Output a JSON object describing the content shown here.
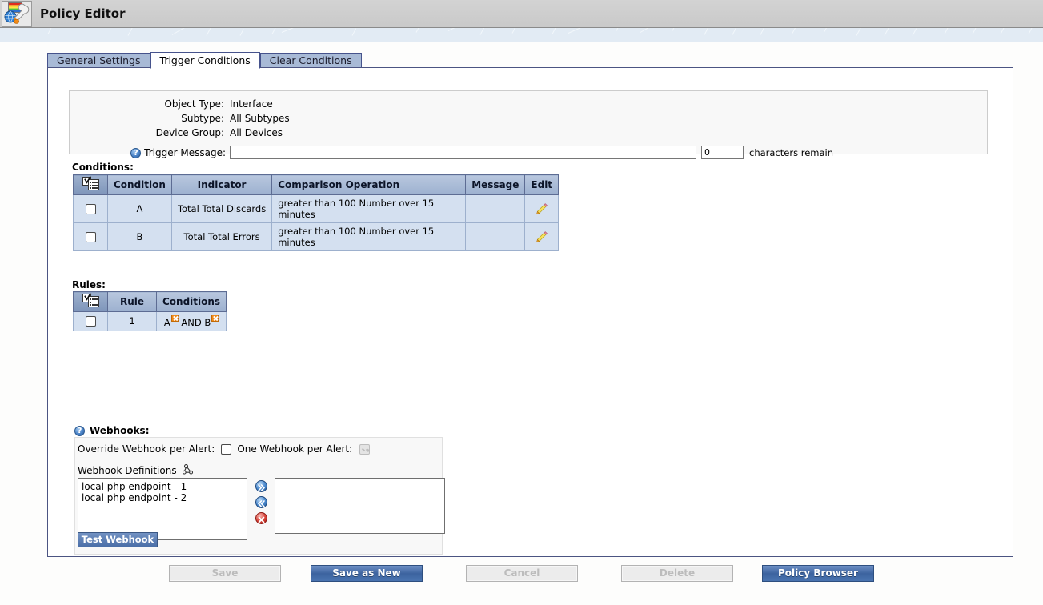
{
  "window": {
    "title": "Policy Editor",
    "app_icon": "globe-wrench-icon"
  },
  "tabs": [
    {
      "label": "General Settings",
      "active": false
    },
    {
      "label": "Trigger Conditions",
      "active": true
    },
    {
      "label": "Clear Conditions",
      "active": false
    }
  ],
  "info": {
    "rows": [
      {
        "label": "Object Type:",
        "value": "Interface"
      },
      {
        "label": "Subtype:",
        "value": "All Subtypes"
      },
      {
        "label": "Device Group:",
        "value": "All Devices"
      }
    ],
    "trigger_message": {
      "help_icon": "help-icon",
      "label": "Trigger Message:",
      "value": "",
      "placeholder": "",
      "count_value": "0",
      "remain_label": "characters remain"
    }
  },
  "conditions": {
    "section_label": "Conditions:",
    "select_all_icon": "select-all-checklist-icon",
    "columns": [
      "",
      "Condition",
      "Indicator",
      "Comparison Operation",
      "Message",
      "Edit"
    ],
    "rows": [
      {
        "checked": false,
        "condition": "A",
        "indicator": "Total Total Discards",
        "comparison": "greater than 100 Number over 15 minutes",
        "message": "",
        "edit_icon": "pencil-icon"
      },
      {
        "checked": false,
        "condition": "B",
        "indicator": "Total Total Errors",
        "comparison": "greater than 100 Number over 15 minutes",
        "message": "",
        "edit_icon": "pencil-icon"
      }
    ]
  },
  "rules": {
    "section_label": "Rules:",
    "select_all_icon": "select-all-checklist-icon",
    "columns": [
      "",
      "Rule",
      "Conditions"
    ],
    "rows": [
      {
        "checked": false,
        "rule": "1",
        "condition_a": "A",
        "operator": "AND",
        "condition_b": "B",
        "remove_icon": "remove-x-badge-icon"
      }
    ]
  },
  "webhooks": {
    "help_icon": "help-icon",
    "title": "Webhooks:",
    "override_label": "Override Webhook per Alert:",
    "override_checked": false,
    "one_per_alert_label": "One Webhook per Alert:",
    "one_per_alert_checked": true,
    "one_per_alert_disabled": true,
    "definitions_label": "Webhook Definitions",
    "definitions_icon": "network-share-icon",
    "available": [
      "local php endpoint - 1",
      "local php endpoint - 2"
    ],
    "selected": [],
    "move_right_icon": "double-chevron-right-icon",
    "move_left_icon": "double-chevron-left-icon",
    "delete_icon": "delete-x-icon",
    "test_button": "Test Webhook"
  },
  "footer_buttons": [
    {
      "label": "Save",
      "state": "disabled"
    },
    {
      "label": "Save as New",
      "state": "primary"
    },
    {
      "label": "Cancel",
      "state": "disabled"
    },
    {
      "label": "Delete",
      "state": "disabled"
    },
    {
      "label": "Policy Browser",
      "state": "primary"
    }
  ],
  "colors": {
    "titlebar": "#d0d0d0",
    "band": "#e2ebf4",
    "tab_inactive": "#a8bad6",
    "panel_border": "#4b5482",
    "grid_header": "#a8bad6",
    "grid_row": "#d4e0f0",
    "primary_button": "#3c639f",
    "badge_orange": "#f08a18",
    "delete_red": "#d9453b"
  }
}
